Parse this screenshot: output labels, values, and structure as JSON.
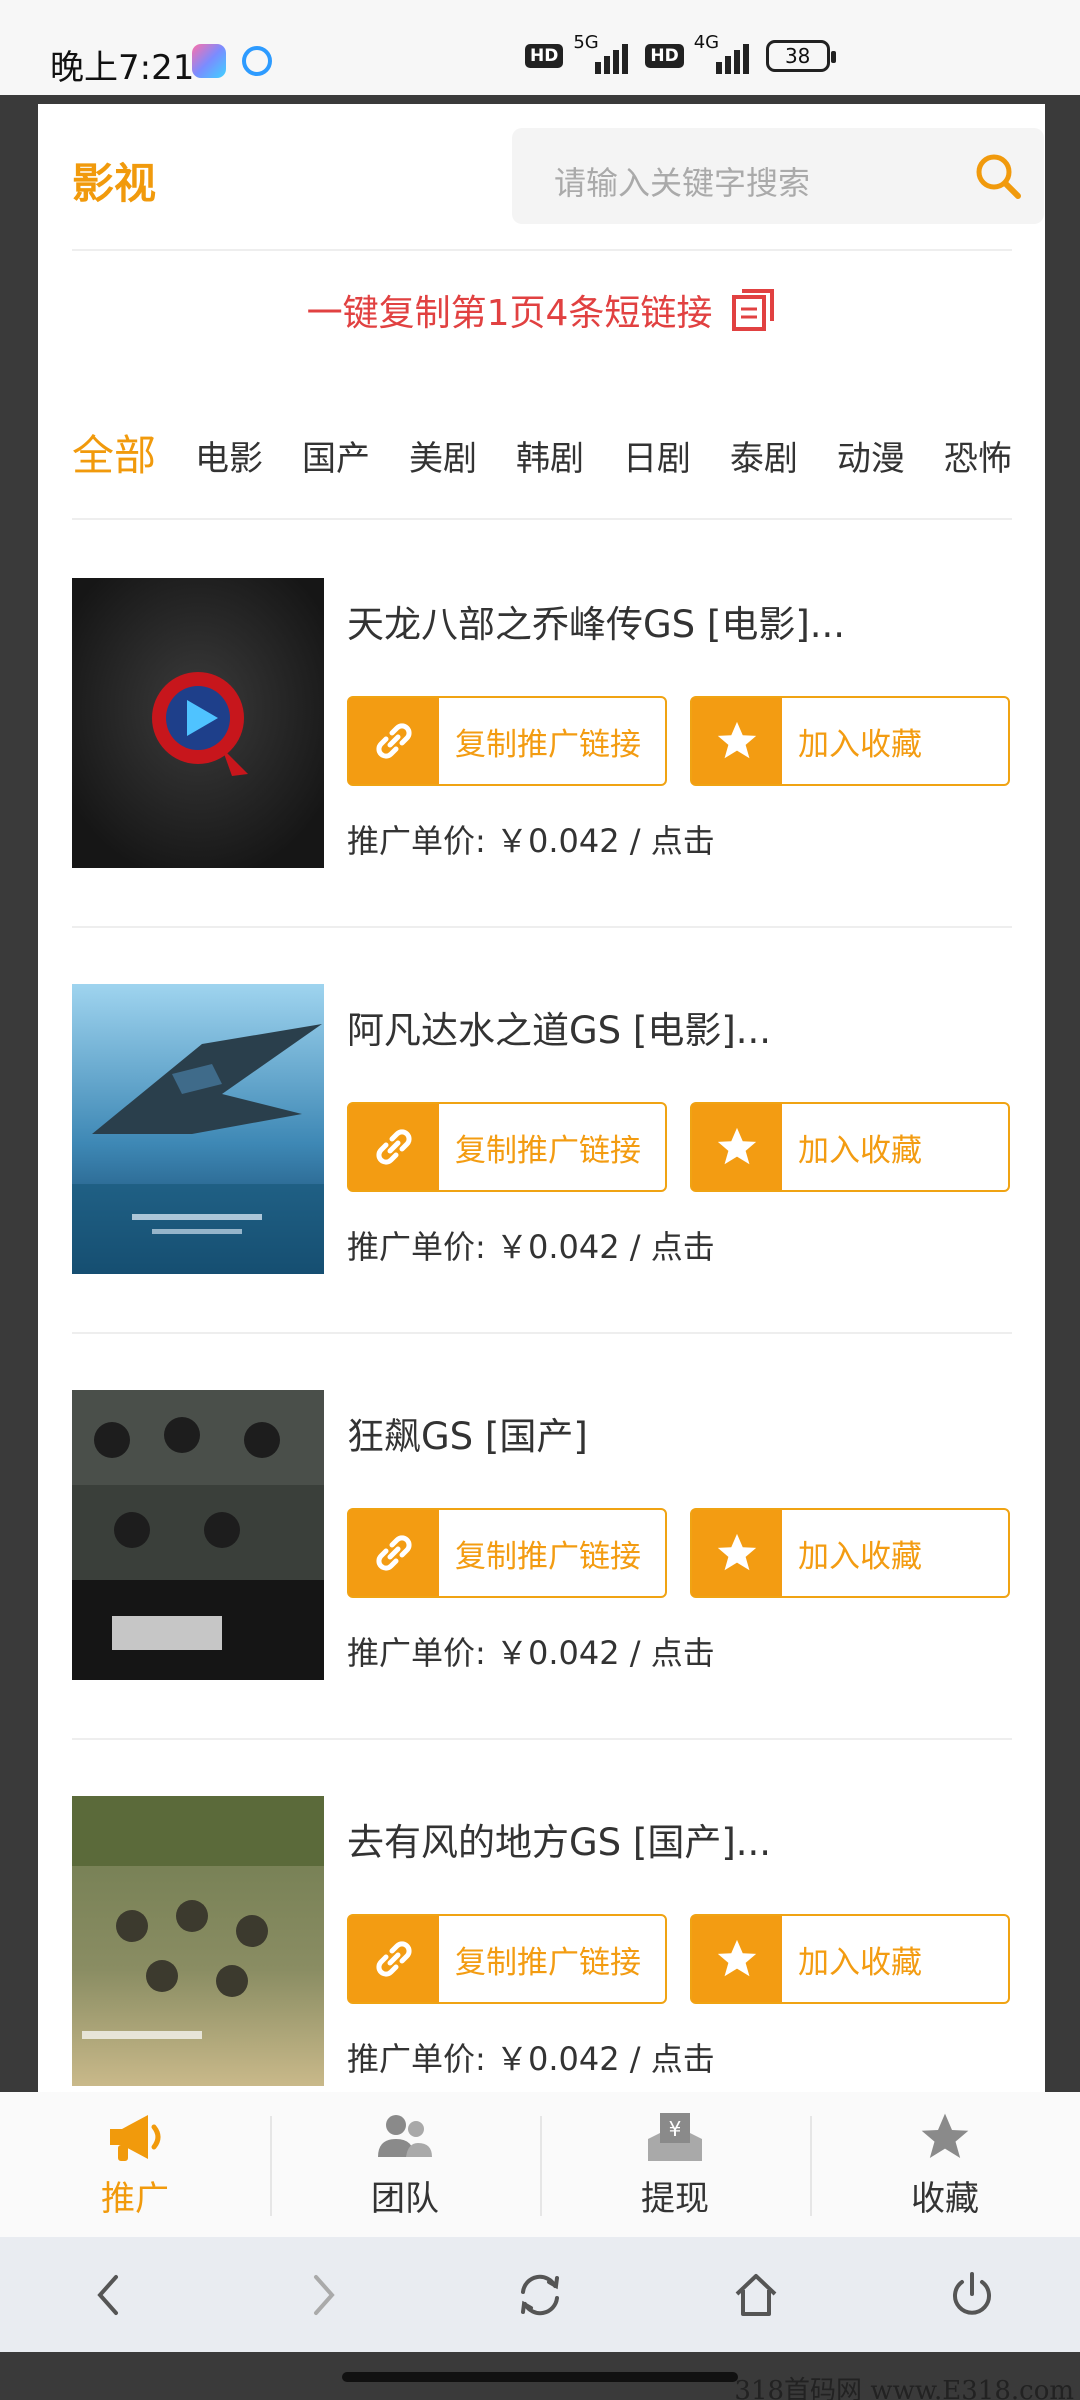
{
  "status_bar": {
    "time": "晚上7:21",
    "hd1": "HD",
    "net1": "5G",
    "hd2": "HD",
    "net2": "4G",
    "battery": "38"
  },
  "header": {
    "brand": "影视",
    "search_placeholder": "请输入关键字搜索"
  },
  "copy_all_label": "一键复制第1页4条短链接",
  "categories": [
    "全部",
    "电影",
    "国产",
    "美剧",
    "韩剧",
    "日剧",
    "泰剧",
    "动漫",
    "恐怖"
  ],
  "items": [
    {
      "title": "天龙八部之乔峰传GS [电影]...",
      "copy_label": "复制推广链接",
      "fav_label": "加入收藏",
      "price": "推广单价: ￥0.042 / 点击"
    },
    {
      "title": "阿凡达水之道GS [电影]...",
      "copy_label": "复制推广链接",
      "fav_label": "加入收藏",
      "price": "推广单价: ￥0.042 / 点击"
    },
    {
      "title": "狂飙GS [国产]",
      "copy_label": "复制推广链接",
      "fav_label": "加入收藏",
      "price": "推广单价: ￥0.042 / 点击"
    },
    {
      "title": "去有风的地方GS [国产]...",
      "copy_label": "复制推广链接",
      "fav_label": "加入收藏",
      "price": "推广单价: ￥0.042 / 点击"
    }
  ],
  "bottom_nav": [
    "推广",
    "团队",
    "提现",
    "收藏"
  ],
  "watermark": "318首码网 www.E318.com",
  "colors": {
    "accent": "#f19a0c",
    "copy_red": "#e14141"
  }
}
